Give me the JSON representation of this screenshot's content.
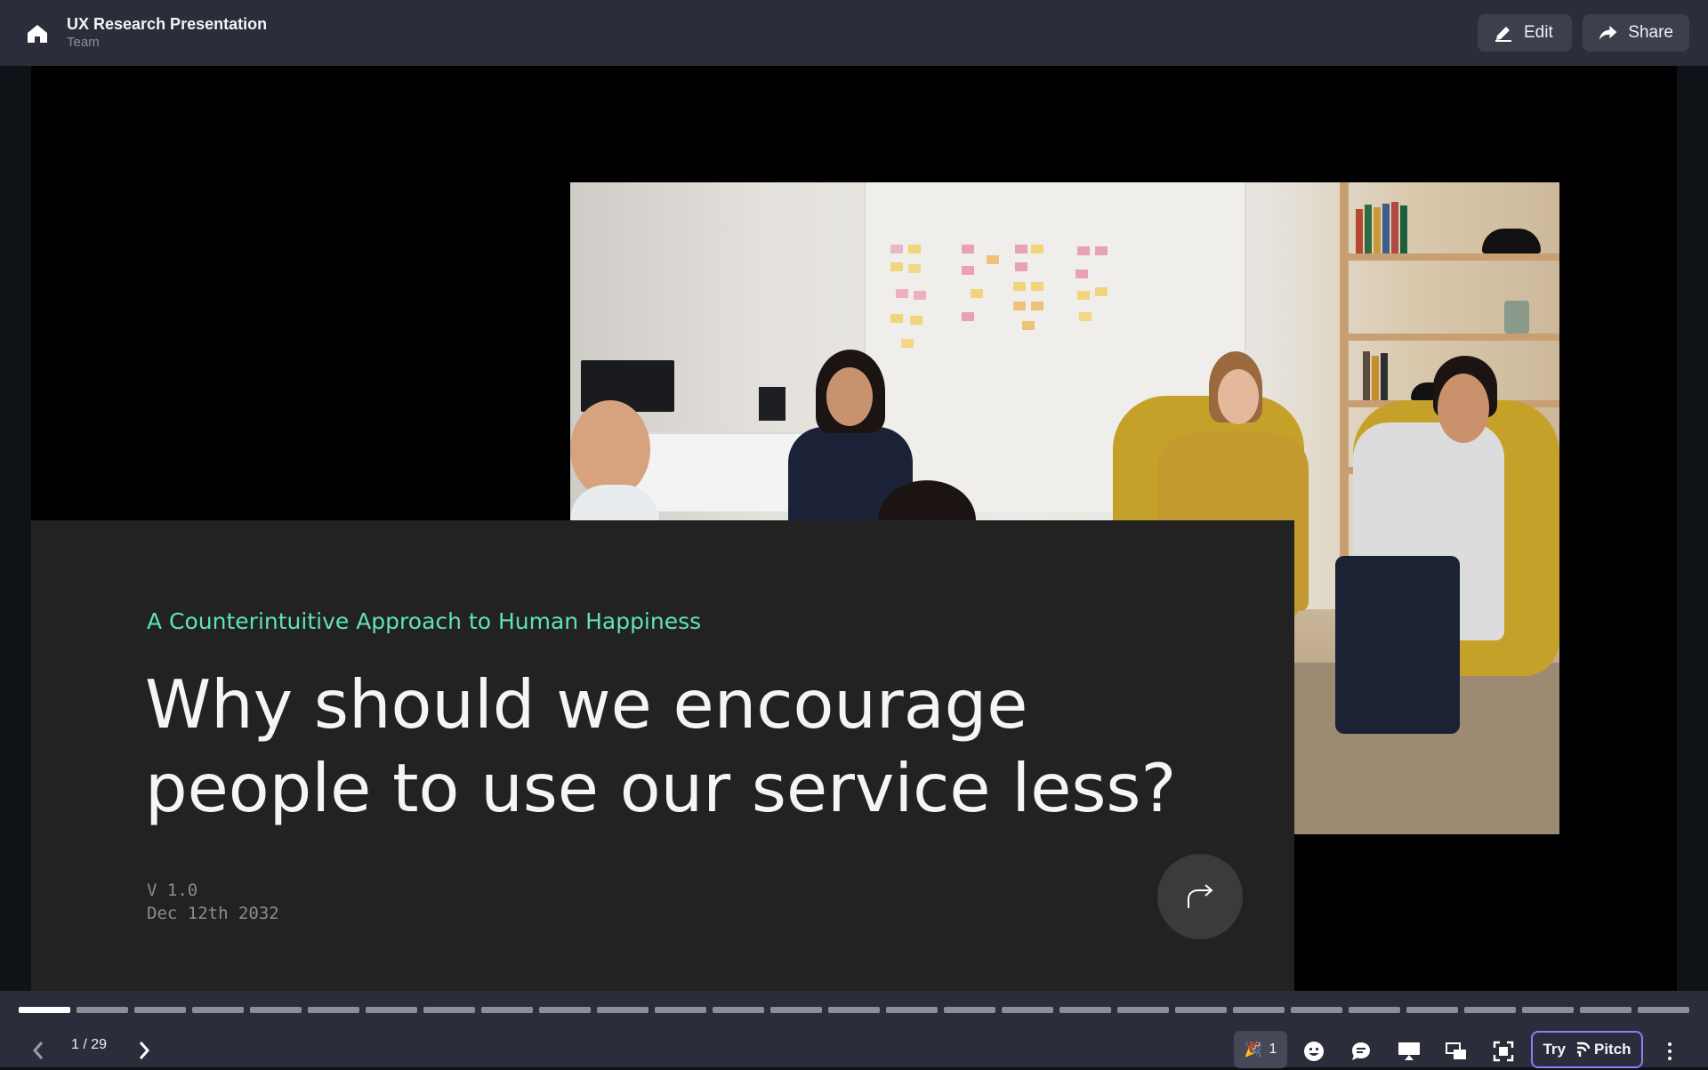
{
  "topbar": {
    "title": "UX Research Presentation",
    "subtitle": "Team",
    "edit_label": "Edit",
    "share_label": "Share"
  },
  "slide": {
    "kicker": "A Counterintuitive Approach to Human Happiness",
    "headline_line1": "Why should we encourage",
    "headline_line2": "people to use our service less?",
    "version": "V 1.0",
    "date": "Dec 12th 2032",
    "accent_color": "#5fe3b4",
    "photo_icon": "team-meeting-photo"
  },
  "player": {
    "current_page": 1,
    "total_pages": 29,
    "pager_text": "1 / 29",
    "reaction_emoji": "🎉",
    "reaction_count": "1",
    "try_label": "Try",
    "brand_label": "Pitch"
  }
}
